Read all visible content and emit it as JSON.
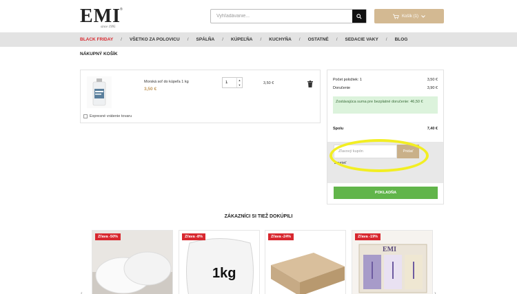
{
  "header": {
    "logo_text": "EMI",
    "logo_sub": "since 1995",
    "search_placeholder": "Vyhľadávanie...",
    "cart_label": "Košík (1)"
  },
  "nav": {
    "items": [
      {
        "label": "BLACK FRIDAY",
        "highlight": true
      },
      {
        "label": "VŠETKO ZA POLOVICU"
      },
      {
        "label": "SPÁLŇA"
      },
      {
        "label": "KÚPEĽŇA"
      },
      {
        "label": "KUCHYŇA"
      },
      {
        "label": "OSTATNÉ"
      },
      {
        "label": "SEDACIE VAKY"
      },
      {
        "label": "BLOG"
      }
    ],
    "separator": "/"
  },
  "page_title": "NÁKUPNÝ KOŠÍK",
  "cart": {
    "item": {
      "name": "Morská soľ do kúpeľa 1 kg",
      "price": "3,50 €",
      "quantity": "1",
      "line_total": "3,50 €"
    },
    "express_return_label": "Expresné vrátenie tovaru"
  },
  "summary": {
    "items_label": "Počet položiek: 1",
    "items_value": "3,50 €",
    "shipping_label": "Doručenie",
    "shipping_value": "3,90 €",
    "free_shipping_note": "Zostávajúca suma pre bezplatné doručenie: 46,50 €",
    "total_label": "Spolu",
    "total_value": "7,40 €",
    "coupon_placeholder": "Zľavový kupón",
    "coupon_button": "Pridať",
    "coupon_close": "Zavrieť",
    "checkout_label": "POKLADŇA"
  },
  "recommended": {
    "title": "ZÁKAZNÍCI SI TIEŽ DOKÚPILI",
    "products": [
      {
        "badge": "Zľava -50%"
      },
      {
        "badge": "Zľava -8%",
        "img_text": "1kg"
      },
      {
        "badge": "Zľava -24%"
      },
      {
        "badge": "Zľava -19%",
        "img_text": "EMI"
      }
    ]
  },
  "colors": {
    "accent": "#d3b992",
    "sale_red": "#d8282f",
    "checkout_green": "#61b54a",
    "highlight_yellow": "#f2ee23"
  }
}
